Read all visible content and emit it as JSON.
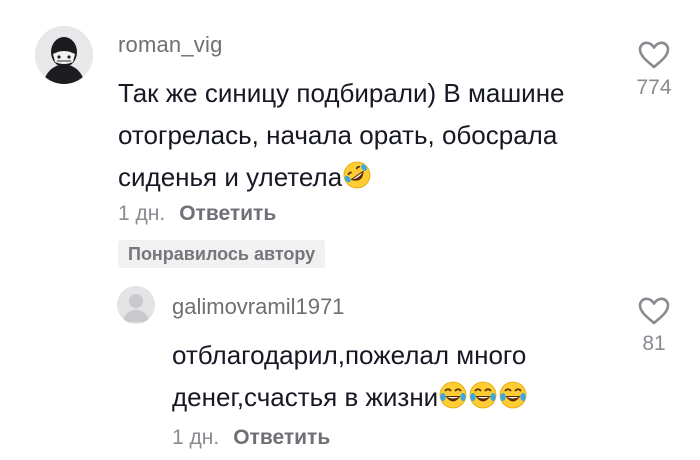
{
  "comment": {
    "username": "roman_vig",
    "text": "Так же синицу подбирали) В машине отогрелась, начала орать, обосрала сиденья и улетела",
    "emoji": "rolling-on-floor-laughing",
    "age": "1 дн.",
    "reply_label": "Ответить",
    "liked_by_author": "Понравилось автору",
    "like_count": "774"
  },
  "reply": {
    "username": "galimovramil1971",
    "text": "отблагодарил,пожелал много денег,счастья в жизни",
    "emoji": "face-with-tears-of-joy",
    "emoji_count": 3,
    "age": "1 дн.",
    "reply_label": "Ответить",
    "like_count": "81"
  },
  "colors": {
    "text_primary": "#161823",
    "text_secondary": "#8a8b91",
    "badge_bg": "#f1f1f2",
    "emoji_yellow": "#ffcc33",
    "emoji_tear": "#3aa7e8"
  }
}
